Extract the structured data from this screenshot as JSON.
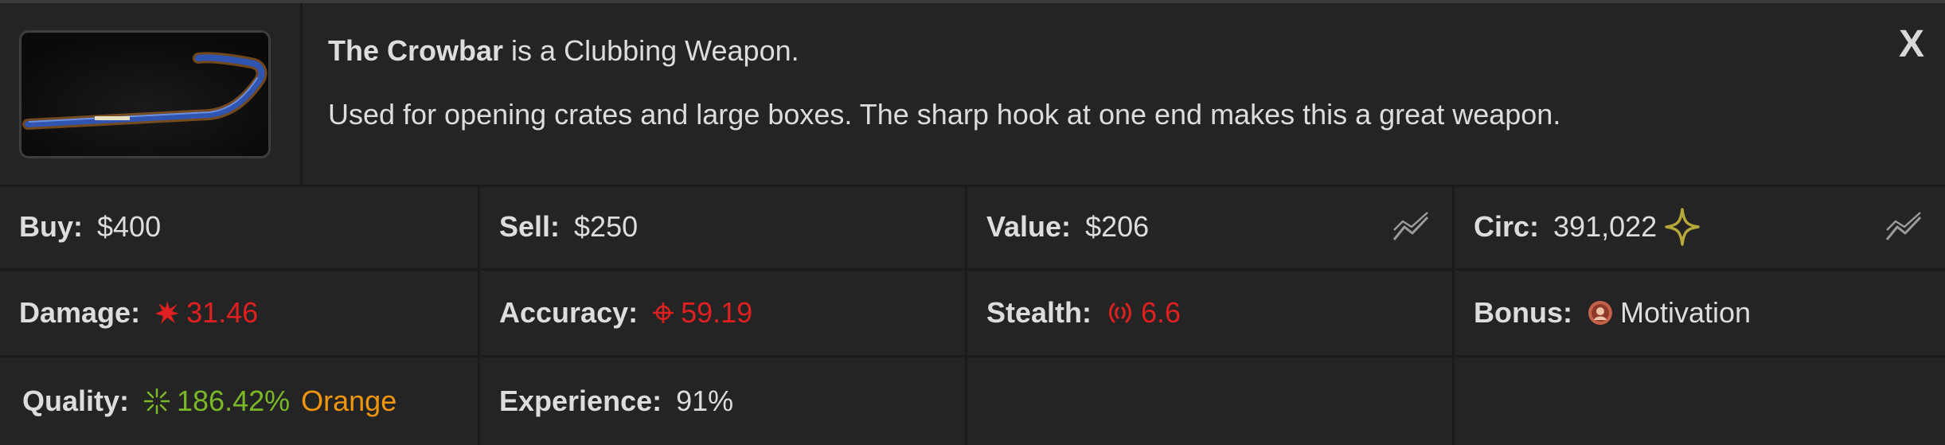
{
  "item": {
    "name": "The Crowbar",
    "type_text": "is a Clubbing Weapon.",
    "description": "Used for opening crates and large boxes. The sharp hook at one end makes this a great weapon.",
    "image_icon": "crowbar-image"
  },
  "close_label": "X",
  "stats": {
    "buy": {
      "label": "Buy:",
      "value": "$400"
    },
    "sell": {
      "label": "Sell:",
      "value": "$250"
    },
    "value": {
      "label": "Value:",
      "value": "$206",
      "icon": "trend-chart-icon"
    },
    "circ": {
      "label": "Circ:",
      "value": "391,022",
      "icon": "sparkle-icon",
      "trend_icon": "trend-chart-icon"
    },
    "damage": {
      "label": "Damage:",
      "value": "31.46",
      "icon": "burst-icon",
      "color": "#e02020"
    },
    "accuracy": {
      "label": "Accuracy:",
      "value": "59.19",
      "icon": "crosshair-icon",
      "color": "#e02020"
    },
    "stealth": {
      "label": "Stealth:",
      "value": "6.6",
      "icon": "signal-waves-icon",
      "color": "#e02020"
    },
    "bonus": {
      "label": "Bonus:",
      "value": "Motivation",
      "icon": "motivation-badge-icon"
    },
    "quality": {
      "label": "Quality:",
      "value": "186.42%",
      "rarity": "Orange",
      "icon": "quality-star-icon",
      "value_color": "#7ab828",
      "rarity_color": "#f0960e"
    },
    "experience": {
      "label": "Experience:",
      "value": "91%"
    }
  }
}
